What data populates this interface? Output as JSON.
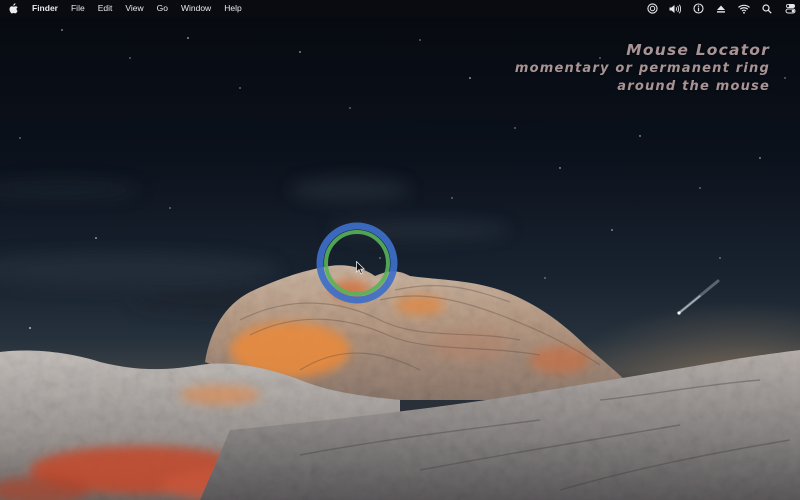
{
  "menubar": {
    "apple_icon": "apple-logo-icon",
    "app_name": "Finder",
    "menus": [
      "File",
      "Edit",
      "View",
      "Go",
      "Window",
      "Help"
    ],
    "status_icons": [
      "screen-record-icon",
      "volume-icon",
      "info-icon",
      "eject-icon",
      "wifi-icon",
      "search-icon",
      "control-center-icon"
    ]
  },
  "caption": {
    "title": "Mouse Locator",
    "line1": "momentary or permanent ring",
    "line2": "around the mouse"
  },
  "locator": {
    "outer_color": "#3d6fc9",
    "inner_color": "#57b25a"
  },
  "wallpaper": {
    "description": "night sky over white and orange sandstone rock formation with comet"
  }
}
